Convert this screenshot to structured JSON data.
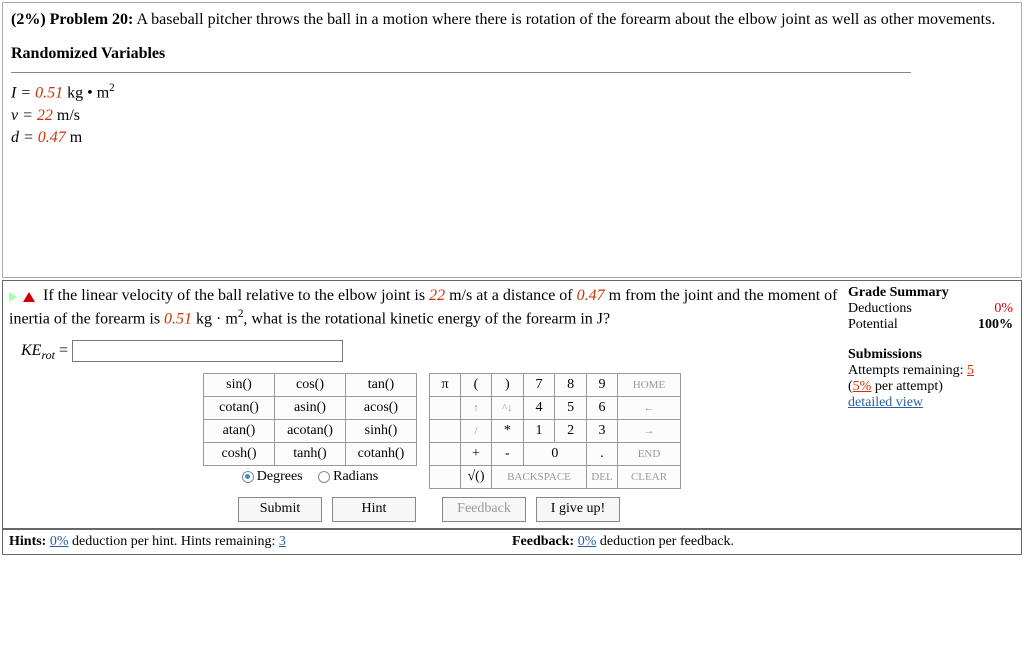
{
  "problem": {
    "percent_label": "(2%)",
    "number_label": "Problem 20:",
    "text_a": "A baseball pitcher throws the ball in a motion where there is rotation of the forearm about the elbow joint as well as other movements.",
    "randomized_header": "Randomized Variables",
    "vars": {
      "I_label": "I = ",
      "I_val": "0.51",
      "I_unit": " kg • m",
      "I_sup": "2",
      "v_label": "v = ",
      "v_val": "22",
      "v_unit": " m/s",
      "d_label": "d = ",
      "d_val": "0.47",
      "d_unit": " m"
    }
  },
  "subpart": {
    "text_before_v": "If the linear velocity of the ball relative to the elbow joint is ",
    "v_val": "22",
    "text_after_v": " m/s at a distance of ",
    "d_val": "0.47",
    "text_after_d": " m from the joint and the moment of inertia of the forearm is ",
    "I_val": "0.51",
    "text_after_I": " kg · m",
    "I_exp": "2",
    "text_end": ", what is the rotational kinetic energy of the forearm in J?",
    "answer_label": "KE",
    "answer_sub": "rot",
    "equals": " = ",
    "answer_value": ""
  },
  "grade": {
    "title": "Grade Summary",
    "deductions_label": "Deductions",
    "deductions_val": "0%",
    "potential_label": "Potential",
    "potential_val": "100%",
    "submissions_title": "Submissions",
    "attempts_label": "Attempts remaining: ",
    "attempts_val": "5",
    "per_attempt_open": "(",
    "per_attempt_val": "5%",
    "per_attempt_close": " per attempt)",
    "detailed_view": "detailed view"
  },
  "keypad": {
    "fns": [
      [
        "sin()",
        "cos()",
        "tan()"
      ],
      [
        "cotan()",
        "asin()",
        "acos()"
      ],
      [
        "atan()",
        "acotan()",
        "sinh()"
      ],
      [
        "cosh()",
        "tanh()",
        "cotanh()"
      ]
    ],
    "deg_label": "Degrees",
    "rad_label": "Radians",
    "row1": [
      "π",
      "(",
      ")",
      "7",
      "8",
      "9",
      "HOME"
    ],
    "row2": [
      "",
      "↑",
      "^↓",
      "4",
      "5",
      "6",
      "←"
    ],
    "row3": [
      "",
      "/",
      "*",
      "1",
      "2",
      "3",
      "→"
    ],
    "row4": [
      "",
      "+",
      "-",
      "0",
      "",
      ".",
      "END"
    ],
    "row5": {
      "sqrt": "√()",
      "back": "BACKSPACE",
      "del": "DEL",
      "clear": "CLEAR"
    }
  },
  "actions": {
    "submit": "Submit",
    "hint": "Hint",
    "feedback": "Feedback",
    "giveup": "I give up!"
  },
  "footer": {
    "hints_label": "Hints: ",
    "hints_pct": "0%",
    "hints_text": " deduction per hint. Hints remaining: ",
    "hints_remaining": "3",
    "feedback_label": "Feedback: ",
    "feedback_pct": "0%",
    "feedback_text": " deduction per feedback."
  }
}
